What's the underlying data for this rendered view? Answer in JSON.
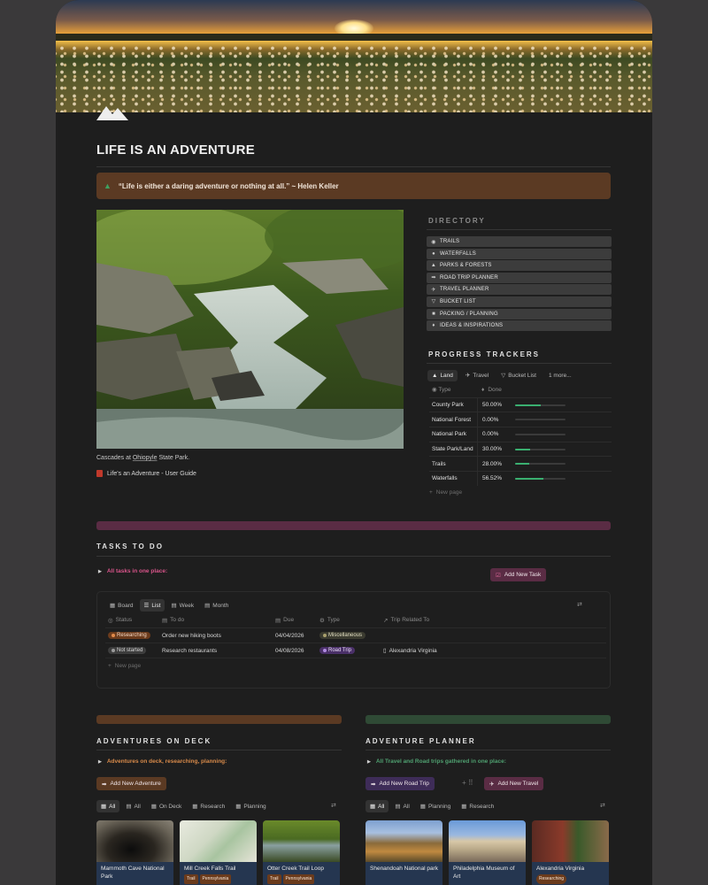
{
  "page": {
    "title": "LIFE IS AN ADVENTURE",
    "quote": "“Life is either a daring adventure or nothing at all.” ~ Helen Keller",
    "photo_caption_prefix": "Cascades at ",
    "photo_caption_link": "Ohiopyle",
    "photo_caption_suffix": " State Park.",
    "guide_link": "Life's an Adventure - User Guide"
  },
  "directory": {
    "label": "DIRECTORY",
    "items": [
      {
        "label": "TRAILS",
        "icon": "compass-icon"
      },
      {
        "label": "WATERFALLS",
        "icon": "drop-icon"
      },
      {
        "label": "PARKS & FORESTS",
        "icon": "mountain-icon"
      },
      {
        "label": "ROAD TRIP PLANNER",
        "icon": "signpost-icon"
      },
      {
        "label": "TRAVEL PLANNER",
        "icon": "airplane-icon"
      },
      {
        "label": "BUCKET LIST",
        "icon": "bucket-icon"
      },
      {
        "label": "PACKING / PLANNING",
        "icon": "backpack-icon"
      },
      {
        "label": "IDEAS & INSPIRATIONS",
        "icon": "lightbulb-icon"
      }
    ]
  },
  "progress": {
    "label": "PROGRESS TRACKERS",
    "tabs": [
      "Land",
      "Travel",
      "Bucket List",
      "1 more..."
    ],
    "col_type": "Type",
    "col_done": "Done",
    "rows": [
      {
        "type": "County Park",
        "done": "50.00%",
        "fraction": 0.5
      },
      {
        "type": "National Forest",
        "done": "0.00%",
        "fraction": 0
      },
      {
        "type": "National Park",
        "done": "0.00%",
        "fraction": 0
      },
      {
        "type": "State Park/Land",
        "done": "30.00%",
        "fraction": 0.3
      },
      {
        "type": "Trails",
        "done": "28.00%",
        "fraction": 0.28
      },
      {
        "type": "Waterfalls",
        "done": "56.52%",
        "fraction": 0.5652
      }
    ],
    "new_page": "New page"
  },
  "tasks": {
    "label": "TASKS TO DO",
    "toggle": "All tasks in one place:",
    "add_button": "Add New Task",
    "views": [
      "Board",
      "List",
      "Week",
      "Month"
    ],
    "columns": [
      "Status",
      "To do",
      "Due",
      "Type",
      "Trip Related To"
    ],
    "rows": [
      {
        "status": "Researching",
        "todo": "Order new hiking boots",
        "due": "04/04/2026",
        "type": "Miscellaneous",
        "trip": ""
      },
      {
        "status": "Not started",
        "todo": "Research restaurants",
        "due": "04/08/2026",
        "type": "Road Trip",
        "trip": "Alexandria Virginia"
      }
    ],
    "new_page": "New page"
  },
  "deck": {
    "label": "ADVENTURES ON DECK",
    "toggle": "Adventures on deck, researching, planning:",
    "add_button": "Add New Adventure",
    "views": [
      "All",
      "All",
      "On Deck",
      "Research",
      "Planning"
    ],
    "cards": [
      {
        "title": "Mammoth Cave National Park",
        "chips": []
      },
      {
        "title": "Mill Creek Falls Trail",
        "chips": [
          "Trail",
          "Pennsylvania"
        ]
      },
      {
        "title": "Otter Creek Trail Loop",
        "chips": [
          "Trail",
          "Pennsylvania"
        ]
      }
    ]
  },
  "planner": {
    "label": "ADVENTURE PLANNER",
    "toggle": "All Travel and Road trips gathered in one place:",
    "road_button": "Add New Road Trip",
    "travel_button": "Add New Travel",
    "views": [
      "All",
      "All",
      "Planning",
      "Research"
    ],
    "cards": [
      {
        "title": "Shenandoah National park",
        "chips": []
      },
      {
        "title": "Philadelphia Museum of Art",
        "chips": []
      },
      {
        "title": "Alexandria Virginia",
        "chips": [
          "Researching"
        ]
      }
    ]
  },
  "colors": {
    "callout": "#5b3a23",
    "tasks_bar": "#5a2c44",
    "deck_bar": "#5b3a23",
    "planner_bar": "#2f4a35",
    "progress_fill": "#3aaf70"
  }
}
